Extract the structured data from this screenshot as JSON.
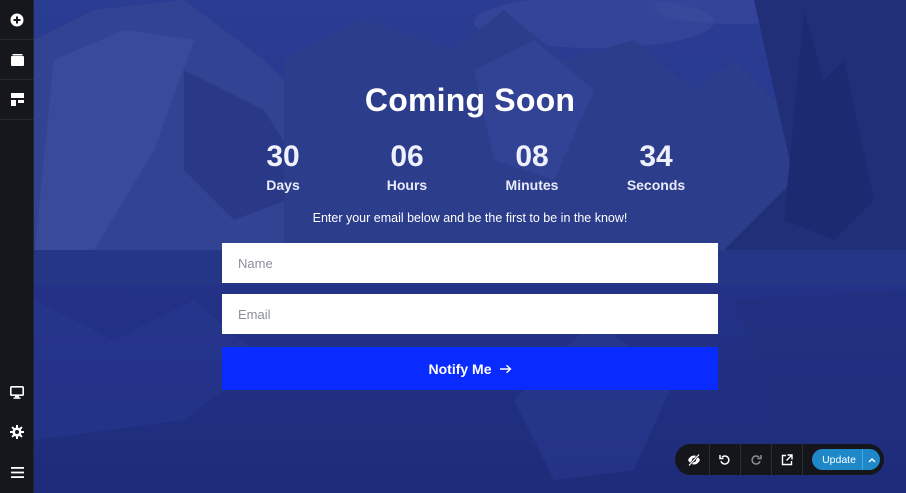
{
  "page": {
    "title": "Coming Soon",
    "tagline": "Enter your email below and be the first to be in the know!"
  },
  "countdown": [
    {
      "value": "30",
      "label": "Days"
    },
    {
      "value": "06",
      "label": "Hours"
    },
    {
      "value": "08",
      "label": "Minutes"
    },
    {
      "value": "34",
      "label": "Seconds"
    }
  ],
  "form": {
    "name_placeholder": "Name",
    "email_placeholder": "Email",
    "submit_label": "Notify Me",
    "submit_icon": "arrow-right-icon"
  },
  "sidebar": {
    "top": [
      "add-icon",
      "layout-icon",
      "blocks-icon"
    ],
    "bottom": [
      "desktop-preview-icon",
      "settings-icon",
      "menu-icon"
    ]
  },
  "toolbar": {
    "icons": [
      "hide-icon",
      "undo-icon",
      "redo-icon",
      "external-link-icon"
    ],
    "update_label": "Update"
  },
  "colors": {
    "overlay": "#1f2f86",
    "button": "#0a2bff",
    "update": "#1e88c9",
    "sidebar": "#15171c"
  }
}
